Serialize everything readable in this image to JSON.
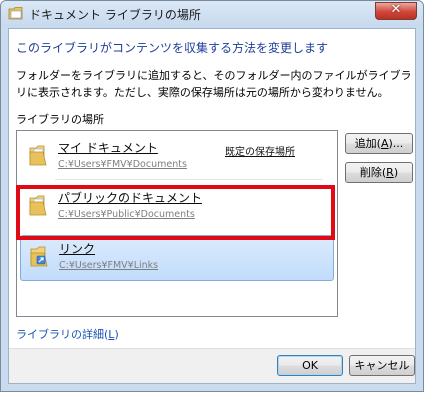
{
  "window": {
    "title": "ドキュメント ライブラリの場所",
    "close_glyph": "✕"
  },
  "heading": "このライブラリがコンテンツを収集する方法を変更します",
  "description": "フォルダーをライブラリに追加すると、そのフォルダー内のファイルがライブラリに表示されます。ただし、実際の保存場所は元の場所から変わりません。",
  "section_label": "ライブラリの場所",
  "locations": [
    {
      "name": "マイ ドキュメント",
      "path": "C:¥Users¥FMV¥Documents",
      "tag": "既定の保存場所",
      "selected": false
    },
    {
      "name": "パブリックのドキュメント",
      "path": "C:¥Users¥Public¥Documents",
      "tag": "",
      "selected": false
    },
    {
      "name": "リンク",
      "path": "C:¥Users¥FMV¥Links",
      "tag": "",
      "selected": true
    }
  ],
  "buttons": {
    "add_label": "追加(",
    "add_key": "A",
    "add_suffix": ")...",
    "remove_label": "削除(",
    "remove_key": "R",
    "remove_suffix": ")",
    "ok_label": "OK",
    "cancel_label": "キャンセル"
  },
  "details_link": {
    "label": "ライブラリの詳細(",
    "key": "L",
    "suffix": ")"
  },
  "colors": {
    "heading_blue": "#1e3f99",
    "highlight_red": "#e00a16",
    "selection": "#c1dcfb"
  }
}
